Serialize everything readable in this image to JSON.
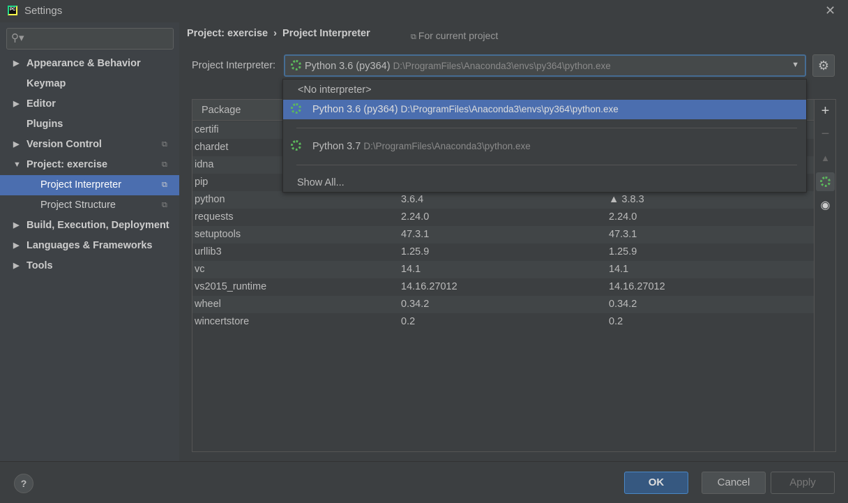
{
  "window": {
    "title": "Settings",
    "app_icon": "PC"
  },
  "sidebar": {
    "items": [
      {
        "label": "Appearance & Behavior",
        "expandable": true
      },
      {
        "label": "Keymap"
      },
      {
        "label": "Editor",
        "expandable": true
      },
      {
        "label": "Plugins"
      },
      {
        "label": "Version Control",
        "expandable": true
      },
      {
        "label": "Project: exercise",
        "expanded": true
      },
      {
        "label": "Project Interpreter",
        "selected": true
      },
      {
        "label": "Project Structure"
      },
      {
        "label": "Build, Execution, Deployment",
        "expandable": true
      },
      {
        "label": "Languages & Frameworks",
        "expandable": true
      },
      {
        "label": "Tools",
        "expandable": true
      }
    ]
  },
  "header": {
    "crumb1": "Project: exercise",
    "crumb2": "Project Interpreter",
    "for_current": "For current project"
  },
  "interpreter": {
    "label": "Project Interpreter:",
    "name": "Python 3.6 (py364)",
    "path": "D:\\ProgramFiles\\Anaconda3\\envs\\py364\\python.exe"
  },
  "popup": {
    "none": "<No interpreter>",
    "opt1": {
      "name": "Python 3.6 (py364)",
      "path": "D:\\ProgramFiles\\Anaconda3\\envs\\py364\\python.exe"
    },
    "opt2": {
      "name": "Python 3.7",
      "path": "D:\\ProgramFiles\\Anaconda3\\python.exe"
    },
    "show_all": "Show All..."
  },
  "table": {
    "header": "Package",
    "rows": [
      [
        "certifi",
        "",
        ""
      ],
      [
        "chardet",
        "",
        ""
      ],
      [
        "idna",
        "",
        ""
      ],
      [
        "pip",
        "",
        ""
      ],
      [
        "python",
        "3.6.4",
        "▲ 3.8.3"
      ],
      [
        "requests",
        "2.24.0",
        "2.24.0"
      ],
      [
        "setuptools",
        "47.3.1",
        "47.3.1"
      ],
      [
        "urllib3",
        "1.25.9",
        "1.25.9"
      ],
      [
        "vc",
        "14.1",
        "14.1"
      ],
      [
        "vs2015_runtime",
        "14.16.27012",
        "14.16.27012"
      ],
      [
        "wheel",
        "0.34.2",
        "0.34.2"
      ],
      [
        "wincertstore",
        "0.2",
        "0.2"
      ]
    ]
  },
  "buttons": {
    "ok": "OK",
    "cancel": "Cancel",
    "apply": "Apply",
    "help": "?"
  },
  "colors": {
    "accent": "#4b6eaf",
    "ok_button": "#365880",
    "spinner": "#5cb85c"
  }
}
